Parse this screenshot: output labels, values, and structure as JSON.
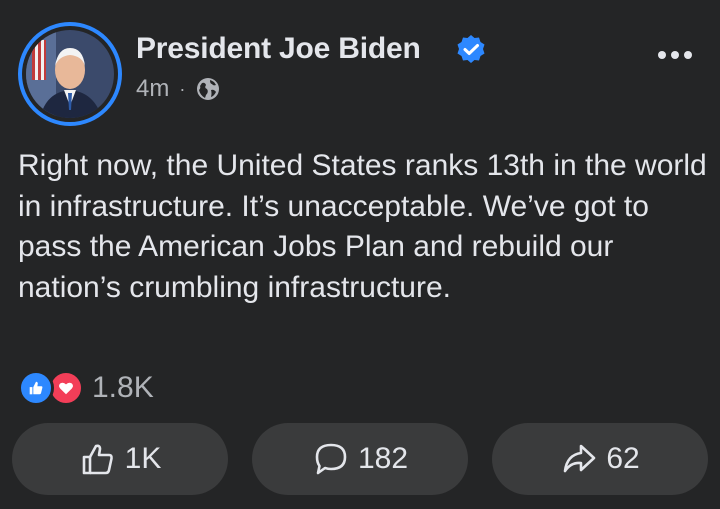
{
  "post": {
    "author": "President Joe Biden",
    "verified": true,
    "timestamp": "4m",
    "separator": "·",
    "audience_icon": "globe-icon",
    "more_icon": "more-dots-icon",
    "body": "Right now, the United States ranks 13th in the world in infrastructure. It’s unacceptable. We’ve got to pass the American Jobs Plan and rebuild our nation’s crumbling infrastructure."
  },
  "reactions": {
    "icons": [
      "like-icon",
      "love-icon"
    ],
    "count": "1.8K"
  },
  "actions": {
    "like": {
      "icon": "thumbs-up-icon",
      "count": "1K"
    },
    "comment": {
      "icon": "comment-icon",
      "count": "182"
    },
    "share": {
      "icon": "share-icon",
      "count": "62"
    }
  },
  "colors": {
    "background": "#242526",
    "text": "#e4e6eb",
    "secondary_text": "#b0b3b8",
    "accent": "#2d88ff",
    "love": "#f33e58",
    "button": "#3a3b3c"
  }
}
